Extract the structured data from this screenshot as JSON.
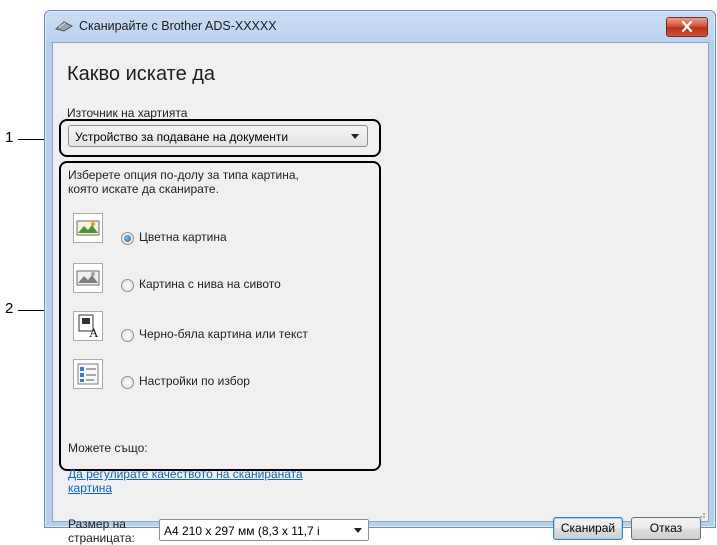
{
  "window": {
    "title": "Сканирайте с Brother ADS-XXXXX"
  },
  "dialog": {
    "heading": "Какво искате да",
    "source_label": "Източник на хартията",
    "source_value": "Устройство за подаване на документи",
    "description_lines": [
      "Изберете опция по-долу за типа картина,",
      "която искате да сканирате."
    ],
    "options": [
      {
        "label": "Цветна картина",
        "checked": true,
        "icon": "color-picture-icon"
      },
      {
        "label": "Картина с нива на сивото",
        "checked": false,
        "icon": "grayscale-picture-icon"
      },
      {
        "label": "Черно-бяла картина или текст",
        "checked": false,
        "icon": "black-white-text-icon"
      },
      {
        "label": "Настройки по избор",
        "checked": false,
        "icon": "custom-settings-icon"
      }
    ],
    "also_label": "Можете също:",
    "link_lines": [
      "Да регулирате качеството на сканираната",
      "картина"
    ],
    "page_size_label_lines": [
      "Размер на",
      "страницата:"
    ],
    "page_size_value": "A4 210 x 297 мм (8,3 x 11,7 i",
    "scan_button": "Сканирай",
    "cancel_button": "Отказ"
  },
  "callouts": {
    "one": "1",
    "two": "2"
  },
  "colors": {
    "link": "#0b65c2",
    "close_button": "#cf4a32",
    "frame": "#b7cfeb"
  }
}
